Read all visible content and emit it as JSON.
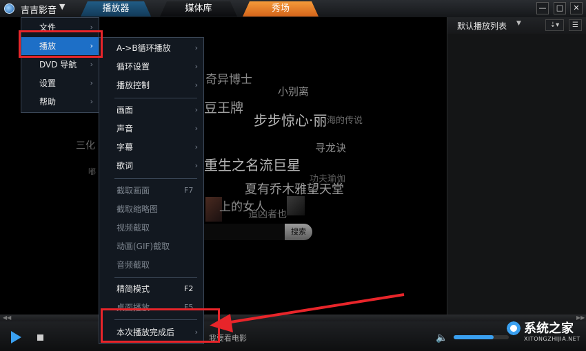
{
  "app": {
    "name": "吉吉影音",
    "caret": "▼"
  },
  "tabs": [
    {
      "label": "播放器"
    },
    {
      "label": "媒体库"
    },
    {
      "label": "秀场"
    }
  ],
  "window_controls": {
    "minimize": "—",
    "restore": "□",
    "close": "✕"
  },
  "playlist": {
    "title": "默认播放列表",
    "caret": "▼",
    "sort_btn": "⇣▾",
    "menu_btn": "☰"
  },
  "cloud_words": [
    "奇异博士",
    "小别离",
    "豆王牌",
    "步步惊心·丽",
    "海的传说",
    "三化",
    "寻龙诀",
    "重生之名流巨星",
    "功夫瑜伽",
    "夏有乔木雅望天堂",
    "上的女人",
    "追凶者也",
    "嘟"
  ],
  "search": {
    "button": "搜索"
  },
  "main_menu": {
    "items": [
      {
        "label": "文件",
        "arrow": "›"
      },
      {
        "label": "播放",
        "arrow": "›"
      },
      {
        "label": "DVD 导航",
        "arrow": "›"
      },
      {
        "label": "设置",
        "arrow": "›"
      },
      {
        "label": "帮助",
        "arrow": "›"
      }
    ]
  },
  "sub_menu": {
    "items": [
      {
        "label": "A->B循环播放",
        "arrow": "›"
      },
      {
        "label": "循环设置",
        "arrow": "›"
      },
      {
        "label": "播放控制",
        "arrow": "›"
      },
      {
        "label": "画面",
        "arrow": "›"
      },
      {
        "label": "声音",
        "arrow": "›"
      },
      {
        "label": "字幕",
        "arrow": "›"
      },
      {
        "label": "歌词",
        "arrow": "›"
      },
      {
        "label": "截取画面",
        "shortcut": "F7"
      },
      {
        "label": "截取缩略图"
      },
      {
        "label": "视频截取"
      },
      {
        "label": "动画(GIF)截取"
      },
      {
        "label": "音频截取"
      },
      {
        "label": "精简模式",
        "shortcut": "F2"
      },
      {
        "label": "桌面播放",
        "shortcut": "F5"
      },
      {
        "label": "本次播放完成后",
        "arrow": "›"
      }
    ]
  },
  "controls": {
    "caption": "我要看电影",
    "volume_level": 0.72,
    "seek_left": "◀◀",
    "seek_right": "▶▶",
    "volume_icon": "🔈"
  },
  "watermark": {
    "name": "系统之家",
    "url": "XITONGZHIJIA.NET"
  },
  "colors": {
    "accent": "#3aa0f0",
    "show_tab": "#f08a30",
    "highlight": "#1d6fc7",
    "annotation": "#e8252a"
  }
}
